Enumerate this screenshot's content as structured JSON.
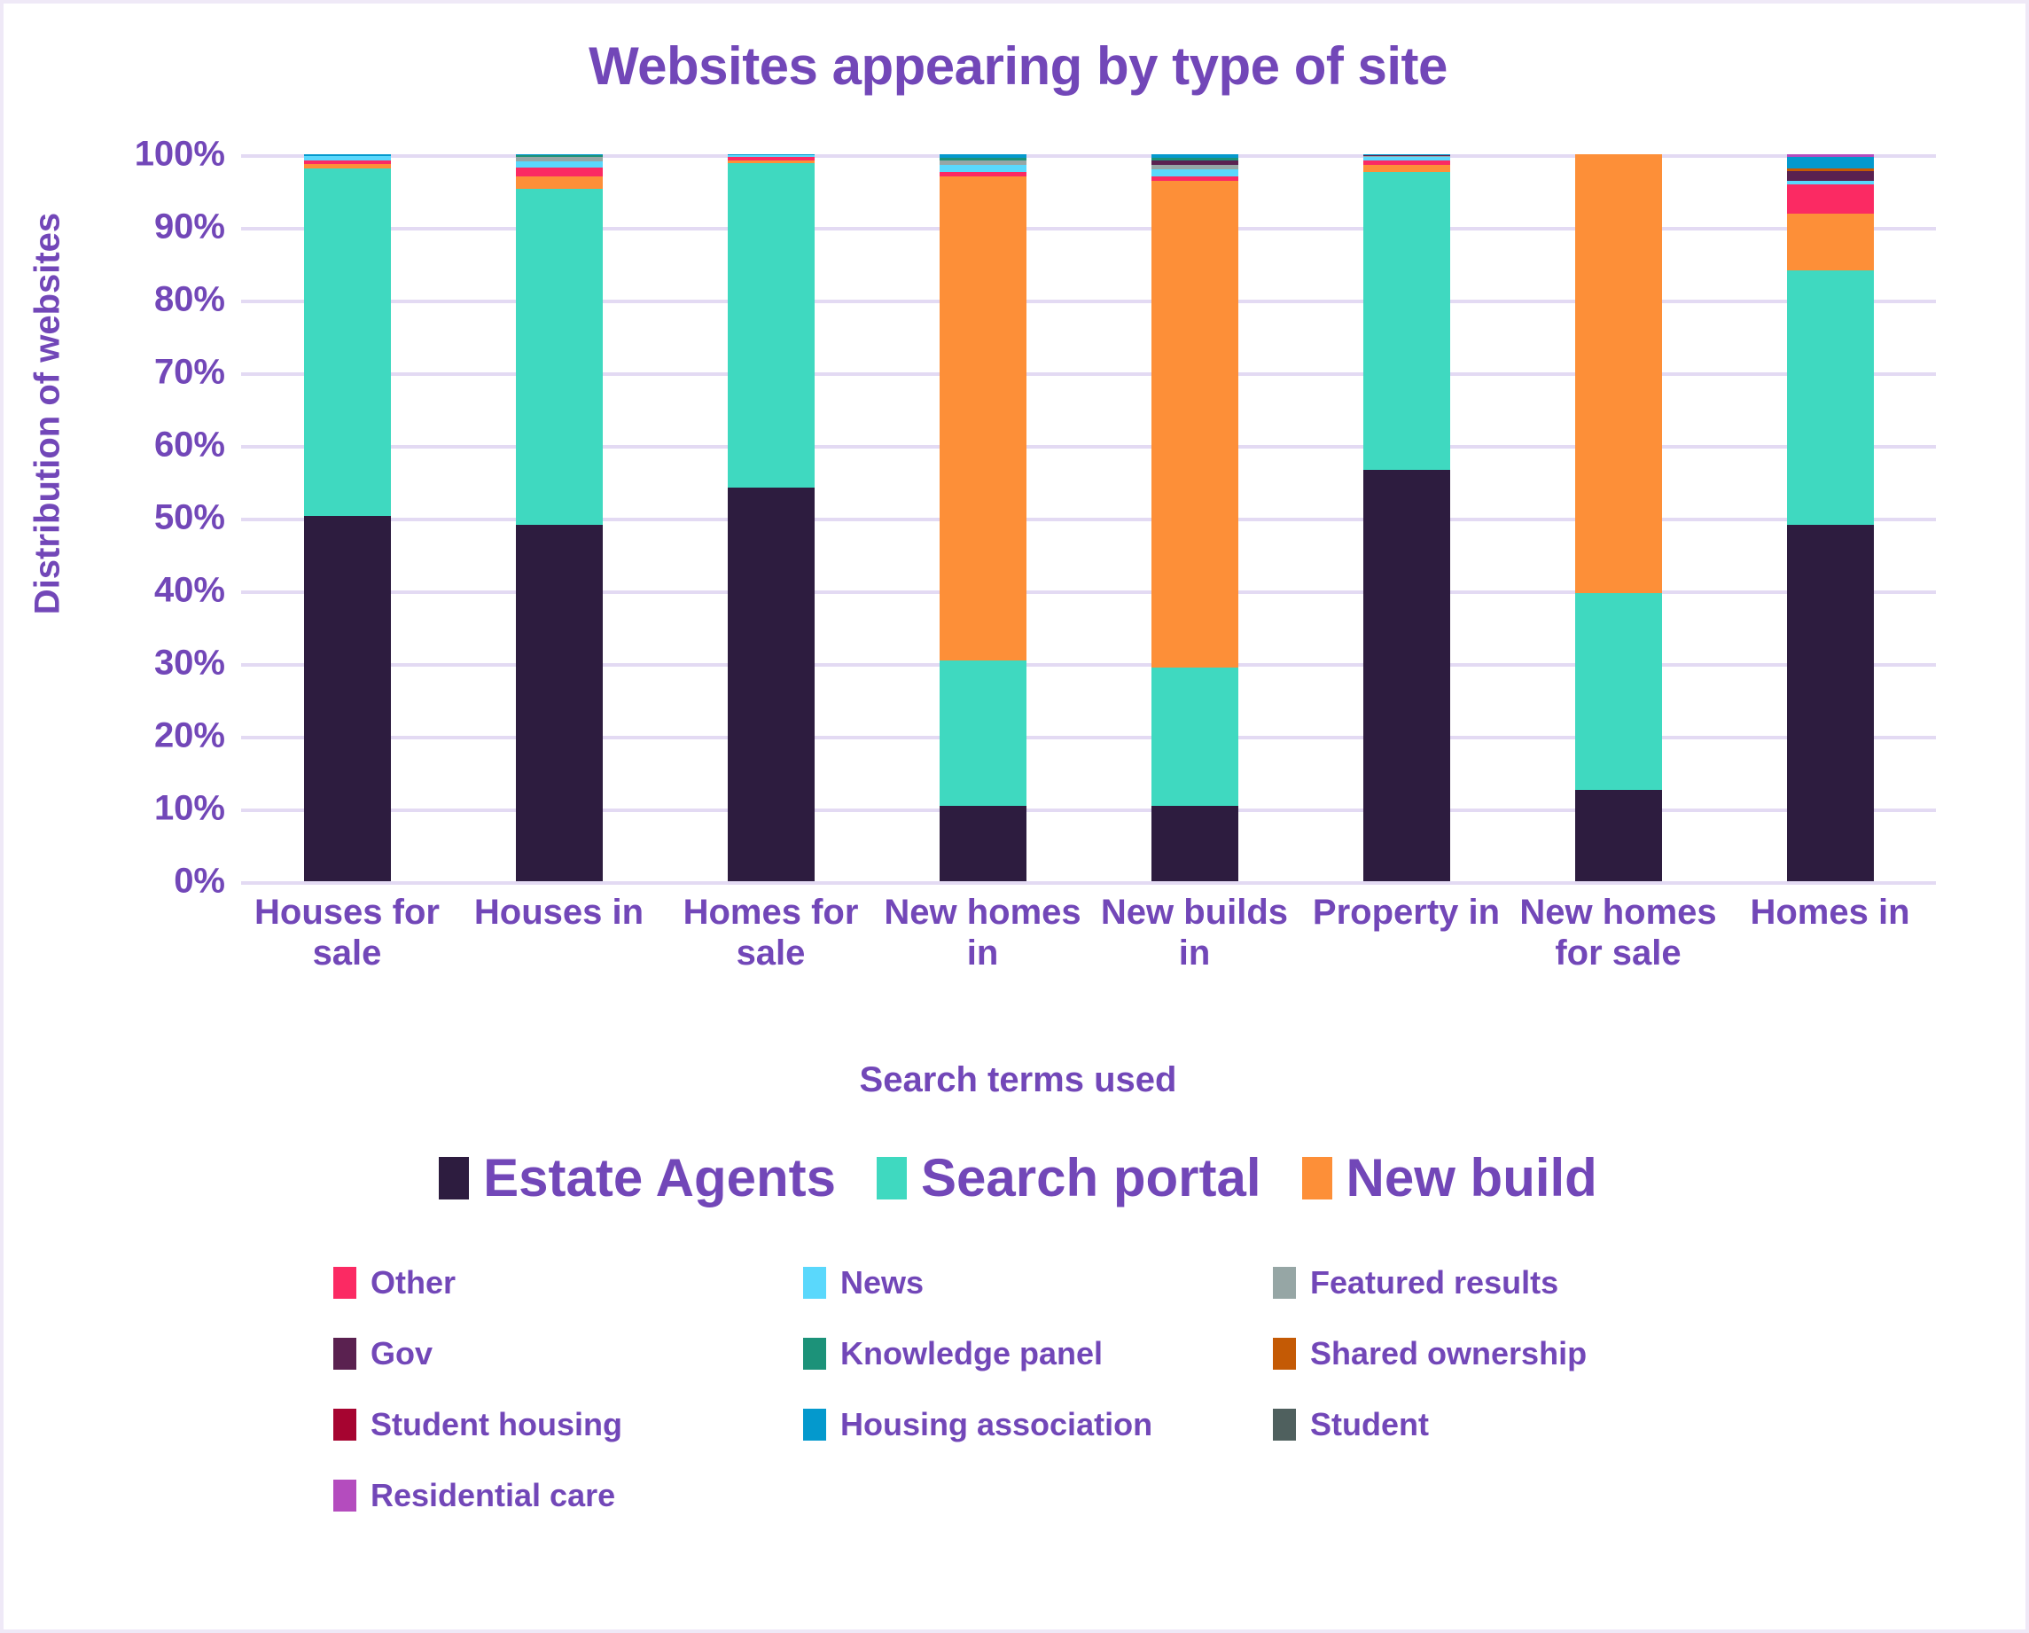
{
  "chart_data": {
    "type": "bar",
    "stacked": true,
    "title": "Websites appearing by type of site",
    "xlabel": "Search terms used",
    "ylabel": "Distribution of websites",
    "ylim": [
      0,
      100
    ],
    "ytick_labels": [
      "0%",
      "10%",
      "20%",
      "30%",
      "40%",
      "50%",
      "60%",
      "70%",
      "80%",
      "90%",
      "100%"
    ],
    "ytick_values": [
      0,
      10,
      20,
      30,
      40,
      50,
      60,
      70,
      80,
      90,
      100
    ],
    "grid": true,
    "legend_position": "bottom",
    "categories": [
      "Houses for sale",
      "Houses in",
      "Homes for sale",
      "New homes in",
      "New builds in",
      "Property in",
      "New homes for sale",
      "Homes in"
    ],
    "series": [
      {
        "name": "Estate Agents",
        "color": "#2d1c3f",
        "values": [
          50.2,
          49.0,
          54.2,
          10.4,
          10.4,
          56.6,
          12.6,
          49.0
        ]
      },
      {
        "name": "Search portal",
        "color": "#3fd9c0",
        "values": [
          47.8,
          46.2,
          44.6,
          20.0,
          19.0,
          41.0,
          27.0,
          35.0
        ]
      },
      {
        "name": "New build",
        "color": "#fd8f38",
        "values": [
          0.7,
          1.8,
          0.4,
          66.6,
          66.9,
          0.9,
          60.4,
          7.8
        ]
      },
      {
        "name": "Other",
        "color": "#fb2a63",
        "values": [
          0.5,
          1.2,
          0.4,
          0.6,
          0.6,
          0.6,
          0.0,
          4.0
        ]
      },
      {
        "name": "News",
        "color": "#5ad8fc",
        "values": [
          0.6,
          0.8,
          0.3,
          1.0,
          1.0,
          0.6,
          0.0,
          0.6
        ]
      },
      {
        "name": "Featured results",
        "color": "#96a6a5",
        "values": [
          0.0,
          0.6,
          0.0,
          0.6,
          0.7,
          0.1,
          0.0,
          0.0
        ]
      },
      {
        "name": "Gov",
        "color": "#5a2150",
        "values": [
          0.0,
          0.0,
          0.0,
          0.0,
          0.5,
          0.1,
          0.0,
          1.3
        ]
      },
      {
        "name": "Knowledge panel",
        "color": "#1c9279",
        "values": [
          0.0,
          0.3,
          0.0,
          0.3,
          0.4,
          0.0,
          0.0,
          0.0
        ]
      },
      {
        "name": "Shared ownership",
        "color": "#c45a05",
        "values": [
          0.0,
          0.0,
          0.0,
          0.0,
          0.0,
          0.0,
          0.0,
          0.4
        ]
      },
      {
        "name": "Student housing",
        "color": "#a60430",
        "values": [
          0.0,
          0.0,
          0.0,
          0.0,
          0.0,
          0.0,
          0.0,
          0.0
        ]
      },
      {
        "name": "Housing association",
        "color": "#0499cd",
        "values": [
          0.2,
          0.1,
          0.1,
          0.5,
          0.5,
          0.1,
          0.0,
          1.5
        ]
      },
      {
        "name": "Student",
        "color": "#4f605e",
        "values": [
          0.0,
          0.0,
          0.0,
          0.0,
          0.0,
          0.0,
          0.0,
          0.0
        ]
      },
      {
        "name": "Residential care",
        "color": "#b44cbe",
        "values": [
          0.0,
          0.0,
          0.0,
          0.0,
          0.0,
          0.0,
          0.0,
          0.4
        ]
      }
    ]
  },
  "legend": {
    "main": [
      {
        "label": "Estate Agents",
        "color": "#2d1c3f"
      },
      {
        "label": "Search portal",
        "color": "#3fd9c0"
      },
      {
        "label": "New build",
        "color": "#fd8f38"
      }
    ],
    "secondary": [
      {
        "label": "Other",
        "color": "#fb2a63"
      },
      {
        "label": "News",
        "color": "#5ad8fc"
      },
      {
        "label": "Featured results",
        "color": "#96a6a5"
      },
      {
        "label": "Gov",
        "color": "#5a2150"
      },
      {
        "label": "Knowledge panel",
        "color": "#1c9279"
      },
      {
        "label": "Shared ownership",
        "color": "#c45a05"
      },
      {
        "label": "Student housing",
        "color": "#a60430"
      },
      {
        "label": "Housing association",
        "color": "#0499cd"
      },
      {
        "label": "Student",
        "color": "#4f605e"
      },
      {
        "label": "Residential care",
        "color": "#b44cbe"
      }
    ]
  },
  "theme": {
    "text_color": "#7247b8",
    "grid_color": "#e3daf3",
    "background": "#ffffff",
    "border_color": "#efe9f7"
  }
}
